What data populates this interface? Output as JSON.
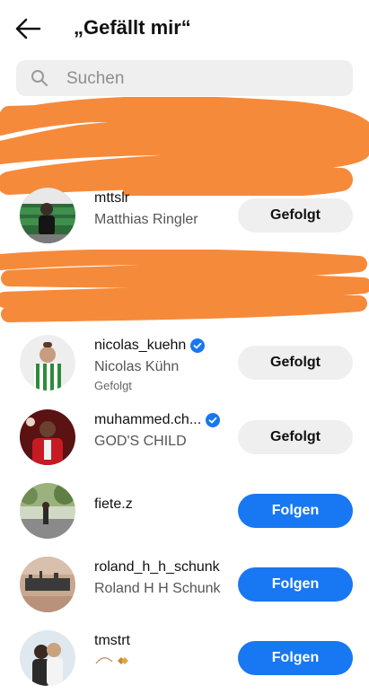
{
  "header": {
    "title": "„Gefällt mir“"
  },
  "search": {
    "placeholder": "Suchen"
  },
  "colors": {
    "primary": "#1877f2",
    "button_gray": "#efefef",
    "scribble": "#f68a3b"
  },
  "users": [
    {
      "username": "mttslr",
      "fullname": "Matthias Ringler",
      "button": "Gefolgt",
      "verified": false,
      "subtitle": ""
    },
    {
      "username": "nicolas_kuehn",
      "fullname": "Nicolas Kühn",
      "button": "Gefolgt",
      "verified": true,
      "subtitle": "Gefolgt"
    },
    {
      "username": "muhammed.ch...",
      "fullname": "GOD'S CHILD",
      "button": "Gefolgt",
      "verified": true,
      "subtitle": ""
    },
    {
      "username": "fiete.z",
      "fullname": "",
      "button": "Folgen",
      "verified": false,
      "subtitle": ""
    },
    {
      "username": "roland_h_h_schunk",
      "fullname": "Roland H H Schunk",
      "button": "Folgen",
      "verified": false,
      "subtitle": ""
    },
    {
      "username": "tmstrt",
      "fullname": "",
      "button": "Folgen",
      "verified": false,
      "subtitle": ""
    }
  ]
}
